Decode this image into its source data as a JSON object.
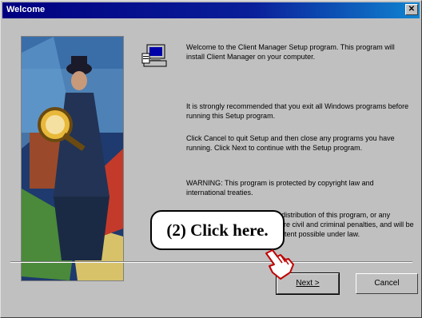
{
  "window": {
    "title": "Welcome",
    "close_label": "✕"
  },
  "content": {
    "welcome_text": "Welcome to the Client Manager Setup program. This program will install Client Manager on your computer.",
    "recommend_text": "It is strongly recommended that you exit all Windows programs before running this Setup program.",
    "cancel_text": "Click Cancel to quit Setup and then close any programs you have running. Click Next to continue with the Setup program.",
    "warning_text": "WARNING: This program is protected by copyright law and international treaties.",
    "unauthorized_text": "Unauthorized reproduction or distribution of this program, or any portion of it, may result in severe civil and criminal penalties, and will be prosecuted to the maximum extent possible under law."
  },
  "buttons": {
    "next_label": "Next >",
    "cancel_label": "Cancel"
  },
  "annotation": {
    "callout_text": "(2)  Click here."
  },
  "icons": {
    "setup": "computer-setup-icon",
    "pointer": "pointing-hand-icon"
  },
  "colors": {
    "titlebar": "#000080",
    "dialog": "#c0c0c0"
  }
}
